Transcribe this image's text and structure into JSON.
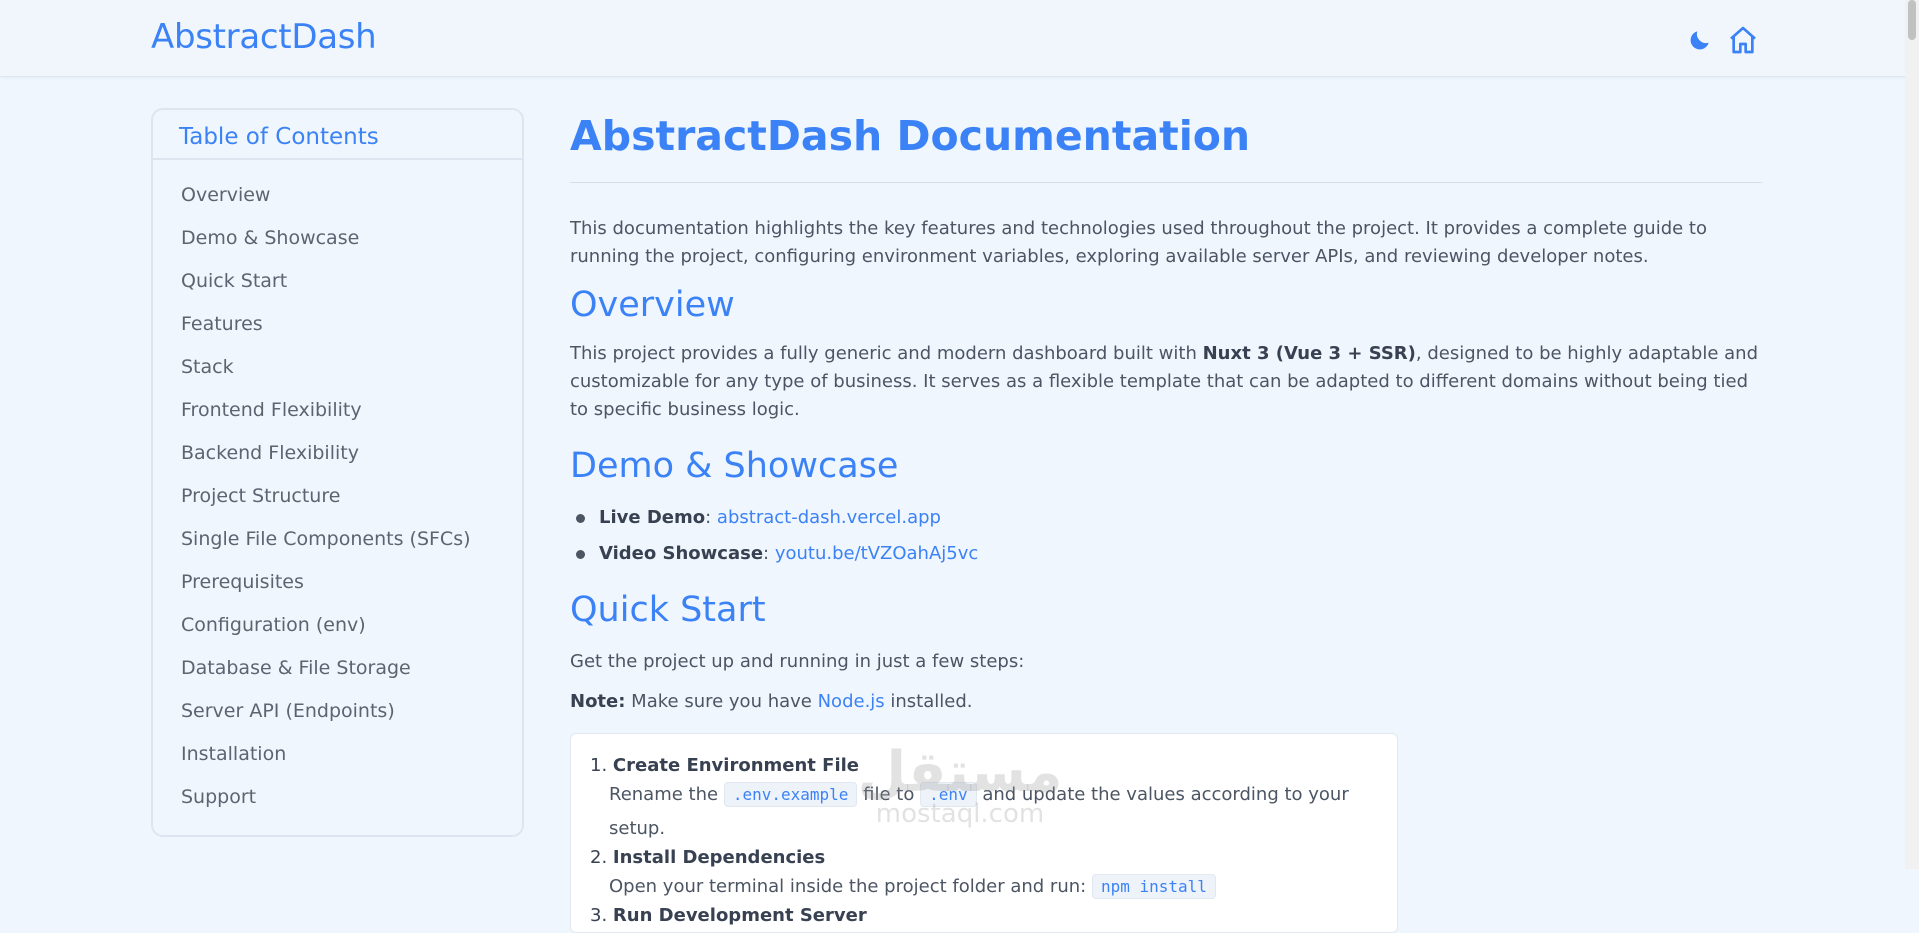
{
  "header": {
    "brand": "AbstractDash",
    "icons": [
      "moon-icon",
      "home-icon"
    ]
  },
  "toc": {
    "title": "Table of Contents",
    "items": [
      "Overview",
      "Demo & Showcase",
      "Quick Start",
      "Features",
      "Stack",
      "Frontend Flexibility",
      "Backend Flexibility",
      "Project Structure",
      "Single File Components (SFCs)",
      "Prerequisites",
      "Configuration (env)",
      "Database & File Storage",
      "Server API (Endpoints)",
      "Installation",
      "Support"
    ]
  },
  "main": {
    "title": "AbstractDash Documentation",
    "intro": "This documentation highlights the key features and technologies used throughout the project. It provides a complete guide to running the project, configuring environment variables, exploring available server APIs, and reviewing developer notes.",
    "overview": {
      "heading": "Overview",
      "text_before": "This project provides a fully generic and modern dashboard built with ",
      "text_bold": "Nuxt 3 (Vue 3 + SSR)",
      "text_after": ", designed to be highly adaptable and customizable for any type of business. It serves as a flexible template that can be adapted to different domains without being tied to specific business logic."
    },
    "demo": {
      "heading": "Demo & Showcase",
      "items": [
        {
          "label": "Live Demo",
          "sep": ": ",
          "link": "abstract-dash.vercel.app"
        },
        {
          "label": "Video Showcase",
          "sep": ": ",
          "link": "youtu.be/tVZOahAj5vc"
        }
      ]
    },
    "quick_start": {
      "heading": "Quick Start",
      "text": "Get the project up and running in just a few steps:",
      "note_label": "Note:",
      "note_before": " Make sure you have ",
      "note_link": "Node.js",
      "note_after": " installed.",
      "steps": [
        {
          "num": "1.",
          "title": "Create Environment File",
          "body_a": "Rename the ",
          "code_a": ".env.example",
          "body_b": " file to ",
          "code_b": ".env",
          "body_c": " and update the values according to your setup."
        },
        {
          "num": "2.",
          "title": "Install Dependencies",
          "body_a": "Open your terminal inside the project folder and run: ",
          "code_a": "npm install"
        },
        {
          "num": "3.",
          "title": "Run Development Server"
        }
      ]
    }
  },
  "watermark": {
    "arabic": "مستقل",
    "latin": "mostaql.com"
  },
  "colors": {
    "accent": "#3b82f6",
    "background": "#f0f6fd",
    "text": "#4b5563"
  }
}
